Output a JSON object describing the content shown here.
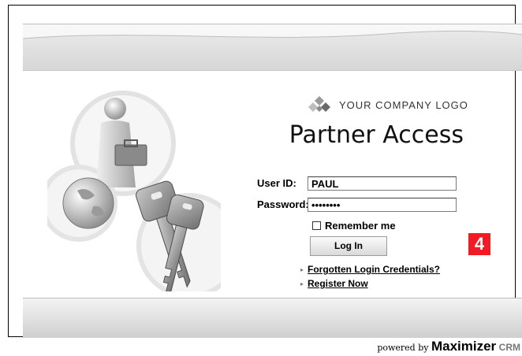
{
  "logo": {
    "text": "YOUR COMPANY LOGO",
    "icon": "diamond-cluster-icon"
  },
  "title": "Partner Access",
  "form": {
    "user_label": "User ID:",
    "user_value": "PAUL",
    "password_label": "Password:",
    "password_value": "••••••••",
    "remember_label": "Remember me",
    "remember_checked": false,
    "login_label": "Log In"
  },
  "links": [
    {
      "label": "Forgotten Login Credentials?"
    },
    {
      "label": "Register Now"
    }
  ],
  "badge": "4",
  "footer": {
    "powered_prefix": "powered by",
    "brand": "Maximizer",
    "product": "CRM"
  },
  "colors": {
    "badge": "#f01b24",
    "band": "#d6d6d6",
    "text": "#000000"
  }
}
